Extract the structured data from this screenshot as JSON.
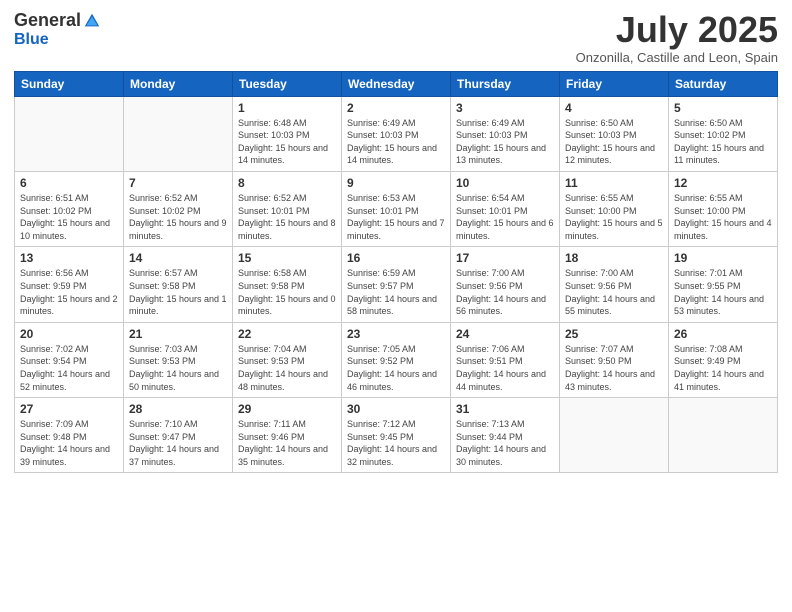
{
  "header": {
    "logo_general": "General",
    "logo_blue": "Blue",
    "month_title": "July 2025",
    "location": "Onzonilla, Castille and Leon, Spain"
  },
  "days_of_week": [
    "Sunday",
    "Monday",
    "Tuesday",
    "Wednesday",
    "Thursday",
    "Friday",
    "Saturday"
  ],
  "weeks": [
    [
      {
        "num": "",
        "info": ""
      },
      {
        "num": "",
        "info": ""
      },
      {
        "num": "1",
        "info": "Sunrise: 6:48 AM\nSunset: 10:03 PM\nDaylight: 15 hours and 14 minutes."
      },
      {
        "num": "2",
        "info": "Sunrise: 6:49 AM\nSunset: 10:03 PM\nDaylight: 15 hours and 14 minutes."
      },
      {
        "num": "3",
        "info": "Sunrise: 6:49 AM\nSunset: 10:03 PM\nDaylight: 15 hours and 13 minutes."
      },
      {
        "num": "4",
        "info": "Sunrise: 6:50 AM\nSunset: 10:03 PM\nDaylight: 15 hours and 12 minutes."
      },
      {
        "num": "5",
        "info": "Sunrise: 6:50 AM\nSunset: 10:02 PM\nDaylight: 15 hours and 11 minutes."
      }
    ],
    [
      {
        "num": "6",
        "info": "Sunrise: 6:51 AM\nSunset: 10:02 PM\nDaylight: 15 hours and 10 minutes."
      },
      {
        "num": "7",
        "info": "Sunrise: 6:52 AM\nSunset: 10:02 PM\nDaylight: 15 hours and 9 minutes."
      },
      {
        "num": "8",
        "info": "Sunrise: 6:52 AM\nSunset: 10:01 PM\nDaylight: 15 hours and 8 minutes."
      },
      {
        "num": "9",
        "info": "Sunrise: 6:53 AM\nSunset: 10:01 PM\nDaylight: 15 hours and 7 minutes."
      },
      {
        "num": "10",
        "info": "Sunrise: 6:54 AM\nSunset: 10:01 PM\nDaylight: 15 hours and 6 minutes."
      },
      {
        "num": "11",
        "info": "Sunrise: 6:55 AM\nSunset: 10:00 PM\nDaylight: 15 hours and 5 minutes."
      },
      {
        "num": "12",
        "info": "Sunrise: 6:55 AM\nSunset: 10:00 PM\nDaylight: 15 hours and 4 minutes."
      }
    ],
    [
      {
        "num": "13",
        "info": "Sunrise: 6:56 AM\nSunset: 9:59 PM\nDaylight: 15 hours and 2 minutes."
      },
      {
        "num": "14",
        "info": "Sunrise: 6:57 AM\nSunset: 9:58 PM\nDaylight: 15 hours and 1 minute."
      },
      {
        "num": "15",
        "info": "Sunrise: 6:58 AM\nSunset: 9:58 PM\nDaylight: 15 hours and 0 minutes."
      },
      {
        "num": "16",
        "info": "Sunrise: 6:59 AM\nSunset: 9:57 PM\nDaylight: 14 hours and 58 minutes."
      },
      {
        "num": "17",
        "info": "Sunrise: 7:00 AM\nSunset: 9:56 PM\nDaylight: 14 hours and 56 minutes."
      },
      {
        "num": "18",
        "info": "Sunrise: 7:00 AM\nSunset: 9:56 PM\nDaylight: 14 hours and 55 minutes."
      },
      {
        "num": "19",
        "info": "Sunrise: 7:01 AM\nSunset: 9:55 PM\nDaylight: 14 hours and 53 minutes."
      }
    ],
    [
      {
        "num": "20",
        "info": "Sunrise: 7:02 AM\nSunset: 9:54 PM\nDaylight: 14 hours and 52 minutes."
      },
      {
        "num": "21",
        "info": "Sunrise: 7:03 AM\nSunset: 9:53 PM\nDaylight: 14 hours and 50 minutes."
      },
      {
        "num": "22",
        "info": "Sunrise: 7:04 AM\nSunset: 9:53 PM\nDaylight: 14 hours and 48 minutes."
      },
      {
        "num": "23",
        "info": "Sunrise: 7:05 AM\nSunset: 9:52 PM\nDaylight: 14 hours and 46 minutes."
      },
      {
        "num": "24",
        "info": "Sunrise: 7:06 AM\nSunset: 9:51 PM\nDaylight: 14 hours and 44 minutes."
      },
      {
        "num": "25",
        "info": "Sunrise: 7:07 AM\nSunset: 9:50 PM\nDaylight: 14 hours and 43 minutes."
      },
      {
        "num": "26",
        "info": "Sunrise: 7:08 AM\nSunset: 9:49 PM\nDaylight: 14 hours and 41 minutes."
      }
    ],
    [
      {
        "num": "27",
        "info": "Sunrise: 7:09 AM\nSunset: 9:48 PM\nDaylight: 14 hours and 39 minutes."
      },
      {
        "num": "28",
        "info": "Sunrise: 7:10 AM\nSunset: 9:47 PM\nDaylight: 14 hours and 37 minutes."
      },
      {
        "num": "29",
        "info": "Sunrise: 7:11 AM\nSunset: 9:46 PM\nDaylight: 14 hours and 35 minutes."
      },
      {
        "num": "30",
        "info": "Sunrise: 7:12 AM\nSunset: 9:45 PM\nDaylight: 14 hours and 32 minutes."
      },
      {
        "num": "31",
        "info": "Sunrise: 7:13 AM\nSunset: 9:44 PM\nDaylight: 14 hours and 30 minutes."
      },
      {
        "num": "",
        "info": ""
      },
      {
        "num": "",
        "info": ""
      }
    ]
  ]
}
